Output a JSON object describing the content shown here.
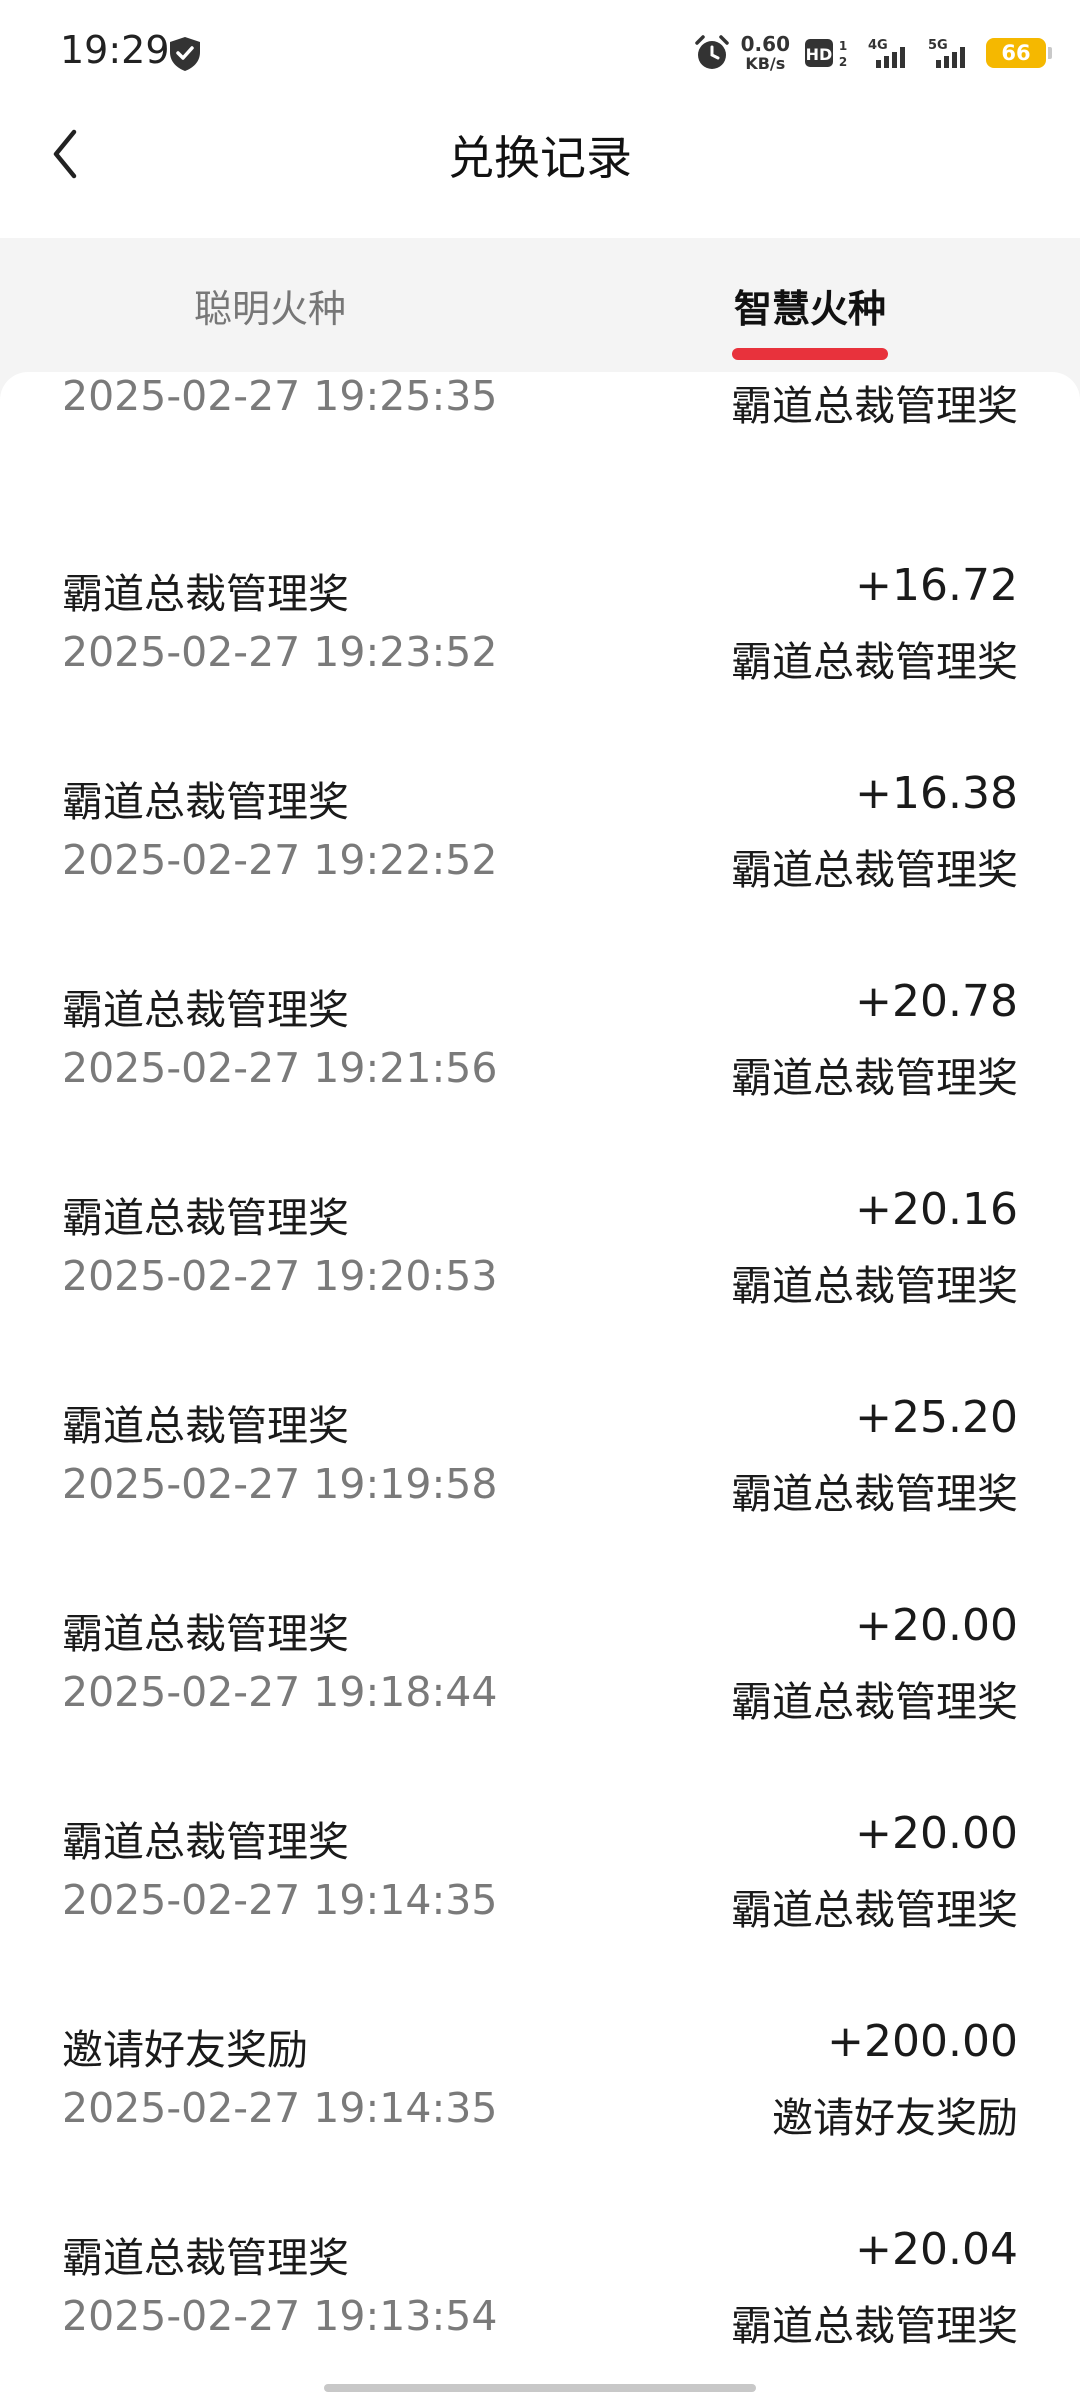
{
  "status": {
    "time": "19:29",
    "net_speed_value": "0.60",
    "net_speed_unit": "KB/s",
    "battery": "66"
  },
  "nav": {
    "title": "兑换记录"
  },
  "tabs": [
    {
      "label": "聪明火种",
      "active": false
    },
    {
      "label": "智慧火种",
      "active": true
    }
  ],
  "first_row": {
    "time": "2025-02-27 19:25:35",
    "type": "霸道总裁管理奖"
  },
  "records": [
    {
      "title": "霸道总裁管理奖",
      "amount": "+16.72",
      "time": "2025-02-27 19:23:52",
      "type": "霸道总裁管理奖"
    },
    {
      "title": "霸道总裁管理奖",
      "amount": "+16.38",
      "time": "2025-02-27 19:22:52",
      "type": "霸道总裁管理奖"
    },
    {
      "title": "霸道总裁管理奖",
      "amount": "+20.78",
      "time": "2025-02-27 19:21:56",
      "type": "霸道总裁管理奖"
    },
    {
      "title": "霸道总裁管理奖",
      "amount": "+20.16",
      "time": "2025-02-27 19:20:53",
      "type": "霸道总裁管理奖"
    },
    {
      "title": "霸道总裁管理奖",
      "amount": "+25.20",
      "time": "2025-02-27 19:19:58",
      "type": "霸道总裁管理奖"
    },
    {
      "title": "霸道总裁管理奖",
      "amount": "+20.00",
      "time": "2025-02-27 19:18:44",
      "type": "霸道总裁管理奖"
    },
    {
      "title": "霸道总裁管理奖",
      "amount": "+20.00",
      "time": "2025-02-27 19:14:35",
      "type": "霸道总裁管理奖"
    },
    {
      "title": "邀请好友奖励",
      "amount": "+200.00",
      "time": "2025-02-27 19:14:35",
      "type": "邀请好友奖励"
    },
    {
      "title": "霸道总裁管理奖",
      "amount": "+20.04",
      "time": "2025-02-27 19:13:54",
      "type": "霸道总裁管理奖"
    }
  ],
  "colors": {
    "accent": "#e8323c",
    "battery": "#f5b800"
  }
}
